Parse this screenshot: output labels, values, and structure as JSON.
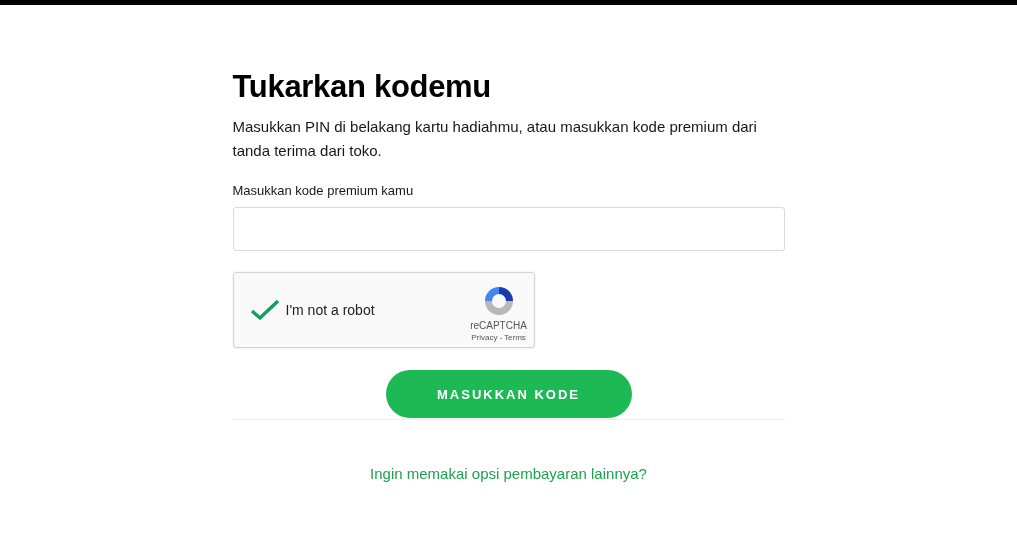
{
  "title": "Tukarkan kodemu",
  "description": "Masukkan PIN di belakang kartu hadiahmu, atau masukkan kode premium dari tanda terima dari toko.",
  "code_field": {
    "label": "Masukkan kode premium kamu"
  },
  "captcha": {
    "checked": true,
    "label": "I'm not a robot",
    "brand": "reCAPTCHA",
    "privacy": "Privacy",
    "separator": "-",
    "terms": "Terms"
  },
  "submit_button": "MASUKKAN KODE",
  "other_payment_link": "Ingin memakai opsi pembayaran lainnya?"
}
